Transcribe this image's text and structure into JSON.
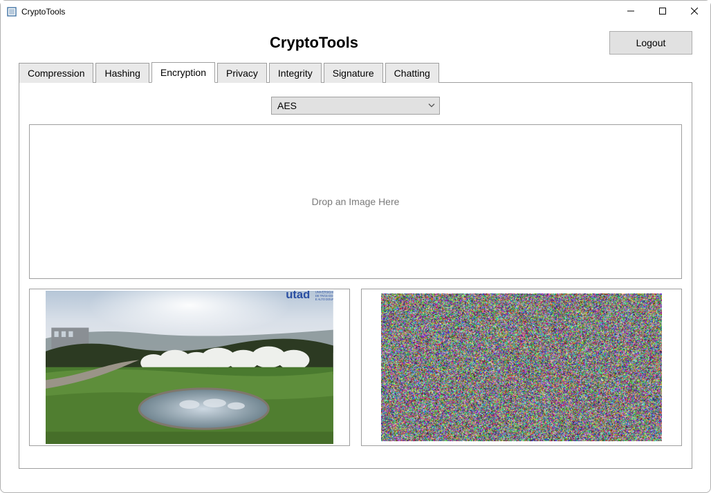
{
  "window": {
    "title": "CryptoTools"
  },
  "header": {
    "app_title": "CryptoTools",
    "logout_label": "Logout"
  },
  "tabs": {
    "items": [
      {
        "label": "Compression"
      },
      {
        "label": "Hashing"
      },
      {
        "label": "Encryption"
      },
      {
        "label": "Privacy"
      },
      {
        "label": "Integrity"
      },
      {
        "label": "Signature"
      },
      {
        "label": "Chatting"
      }
    ],
    "active_index": 2
  },
  "encryption": {
    "algorithm_selected": "AES",
    "dropzone_hint": "Drop an Image Here",
    "original_image": {
      "logo_text": "utad",
      "logo_sub1": "UNIVERSIDADE",
      "logo_sub2": "DE TRÁS-OS-MONTES",
      "logo_sub3": "E ALTO DOURO"
    }
  }
}
